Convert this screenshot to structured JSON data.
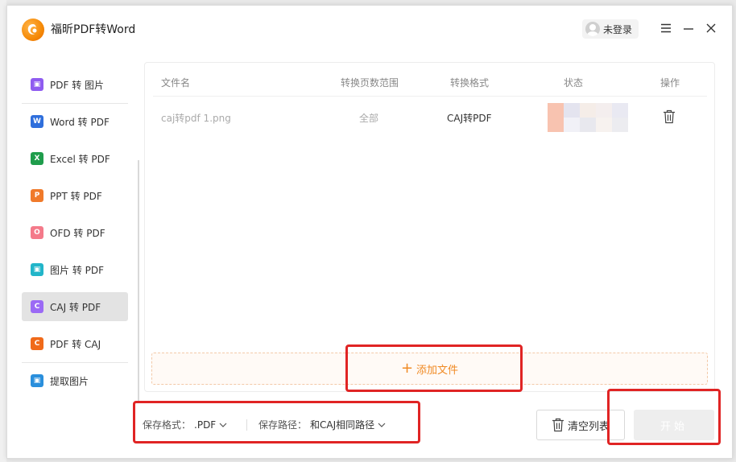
{
  "app": {
    "title": "福昕PDF转Word",
    "user_label": "未登录"
  },
  "sidebar": {
    "items": [
      {
        "label": "PDF 转 图片",
        "icon": "pdf-to-image-icon",
        "color": "#8f5cf0",
        "glyph": "▣"
      },
      {
        "label": "Word 转 PDF",
        "icon": "word-icon",
        "color": "#2f6fdc",
        "glyph": "W"
      },
      {
        "label": "Excel 转 PDF",
        "icon": "excel-icon",
        "color": "#1f9d4c",
        "glyph": "X"
      },
      {
        "label": "PPT 转 PDF",
        "icon": "ppt-icon",
        "color": "#f07a2a",
        "glyph": "P"
      },
      {
        "label": "OFD 转 PDF",
        "icon": "ofd-icon",
        "color": "#f47a8a",
        "glyph": "O"
      },
      {
        "label": "图片 转 PDF",
        "icon": "image-to-pdf-icon",
        "color": "#22b5c9",
        "glyph": "▣"
      },
      {
        "label": "CAJ 转 PDF",
        "icon": "caj-icon",
        "color": "#9b6af5",
        "glyph": "C"
      },
      {
        "label": "PDF 转 CAJ",
        "icon": "pdf-to-caj-icon",
        "color": "#f06a1a",
        "glyph": "C"
      },
      {
        "label": "提取图片",
        "icon": "extract-image-icon",
        "color": "#2a8fdc",
        "glyph": "▣"
      }
    ]
  },
  "table": {
    "headers": {
      "filename": "文件名",
      "range": "转换页数范围",
      "format": "转换格式",
      "status": "状态",
      "action": "操作"
    },
    "rows": [
      {
        "filename": "caj转pdf 1.png",
        "range": "全部",
        "format": "CAJ转PDF"
      }
    ]
  },
  "add_file_label": "添加文件",
  "bottom": {
    "save_format_label": "保存格式：",
    "save_format_value": ".PDF",
    "save_path_label": "保存路径：",
    "save_path_value": "和CAJ相同路径",
    "clear_label": "清空列表",
    "start_label": "开始"
  },
  "colors": {
    "accent": "#f08a24",
    "annotation": "#e02424"
  }
}
